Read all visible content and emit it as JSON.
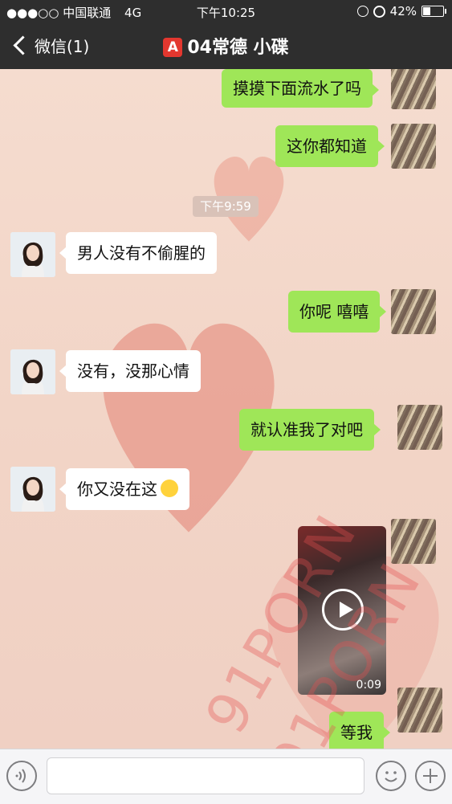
{
  "status_bar": {
    "signal": "●●●○○",
    "carrier": "中国联通",
    "network": "4G",
    "time": "下午10:25",
    "battery": "42%",
    "battery_level": 0.42
  },
  "nav": {
    "back_label": "微信(1)",
    "badge": "A",
    "title": "04常德 小碟"
  },
  "chat": {
    "timestamp": "下午9:59",
    "messages": [
      {
        "side": "out",
        "text": "摸摸下面流水了吗"
      },
      {
        "side": "out",
        "text": "这你都知道"
      },
      {
        "side": "in",
        "text": "男人没有不偷腥的"
      },
      {
        "side": "out",
        "text": "你呢 嘻嘻"
      },
      {
        "side": "in",
        "text": "没有，没那心情"
      },
      {
        "side": "out",
        "text": "就认准我了对吧"
      },
      {
        "side": "in",
        "text": "你又没在这",
        "emoji": "thinking-face-emoji"
      },
      {
        "side": "out",
        "type": "video",
        "duration": "0:09"
      },
      {
        "side": "out",
        "text": "等我"
      }
    ],
    "watermark": "91PORN"
  },
  "input_bar": {
    "voice_icon": "voice-icon",
    "emoji_icon": "emoji-face-icon",
    "plus_icon": "plus-icon"
  }
}
